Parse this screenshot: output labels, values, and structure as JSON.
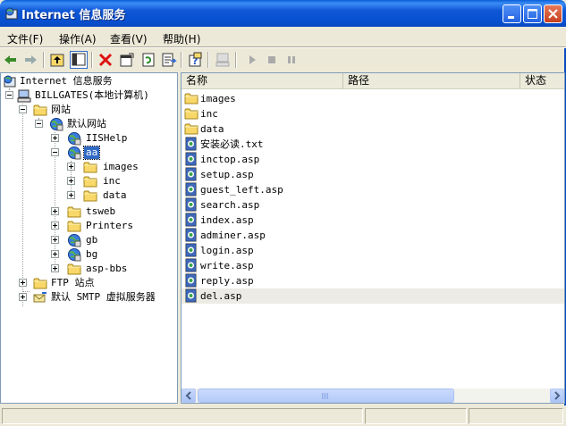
{
  "window": {
    "title": "Internet 信息服务"
  },
  "menu": [
    "文件(F)",
    "操作(A)",
    "查看(V)",
    "帮助(H)"
  ],
  "toolbar": [
    "back-icon",
    "forward-icon",
    "up-icon",
    "show-tree-icon",
    "delete-icon",
    "properties-icon",
    "refresh-icon",
    "export-list-icon",
    "help-icon",
    "computer-icon",
    "start-icon",
    "stop-icon",
    "pause-icon"
  ],
  "tree": {
    "root": "Internet 信息服务",
    "computer": "BILLGATES(本地计算机)",
    "websites": "网站",
    "default_site": "默认网站",
    "iishelp": "IISHelp",
    "aa": "aa",
    "aa_children": [
      "images",
      "inc",
      "data"
    ],
    "tsweb": "tsweb",
    "printers": "Printers",
    "gb": "gb",
    "bg": "bg",
    "aspbbs": "asp-bbs",
    "ftp": "FTP 站点",
    "smtp": "默认 SMTP 虚拟服务器"
  },
  "list": {
    "columns": [
      "名称",
      "路径",
      "状态"
    ],
    "items": [
      {
        "name": "images",
        "type": "folder"
      },
      {
        "name": "inc",
        "type": "folder"
      },
      {
        "name": "data",
        "type": "folder"
      },
      {
        "name": "安装必读.txt",
        "type": "file"
      },
      {
        "name": "inctop.asp",
        "type": "file"
      },
      {
        "name": "setup.asp",
        "type": "file"
      },
      {
        "name": "guest_left.asp",
        "type": "file"
      },
      {
        "name": "search.asp",
        "type": "file"
      },
      {
        "name": "index.asp",
        "type": "file"
      },
      {
        "name": "adminer.asp",
        "type": "file"
      },
      {
        "name": "login.asp",
        "type": "file"
      },
      {
        "name": "write.asp",
        "type": "file"
      },
      {
        "name": "reply.asp",
        "type": "file"
      },
      {
        "name": "del.asp",
        "type": "file"
      }
    ]
  }
}
